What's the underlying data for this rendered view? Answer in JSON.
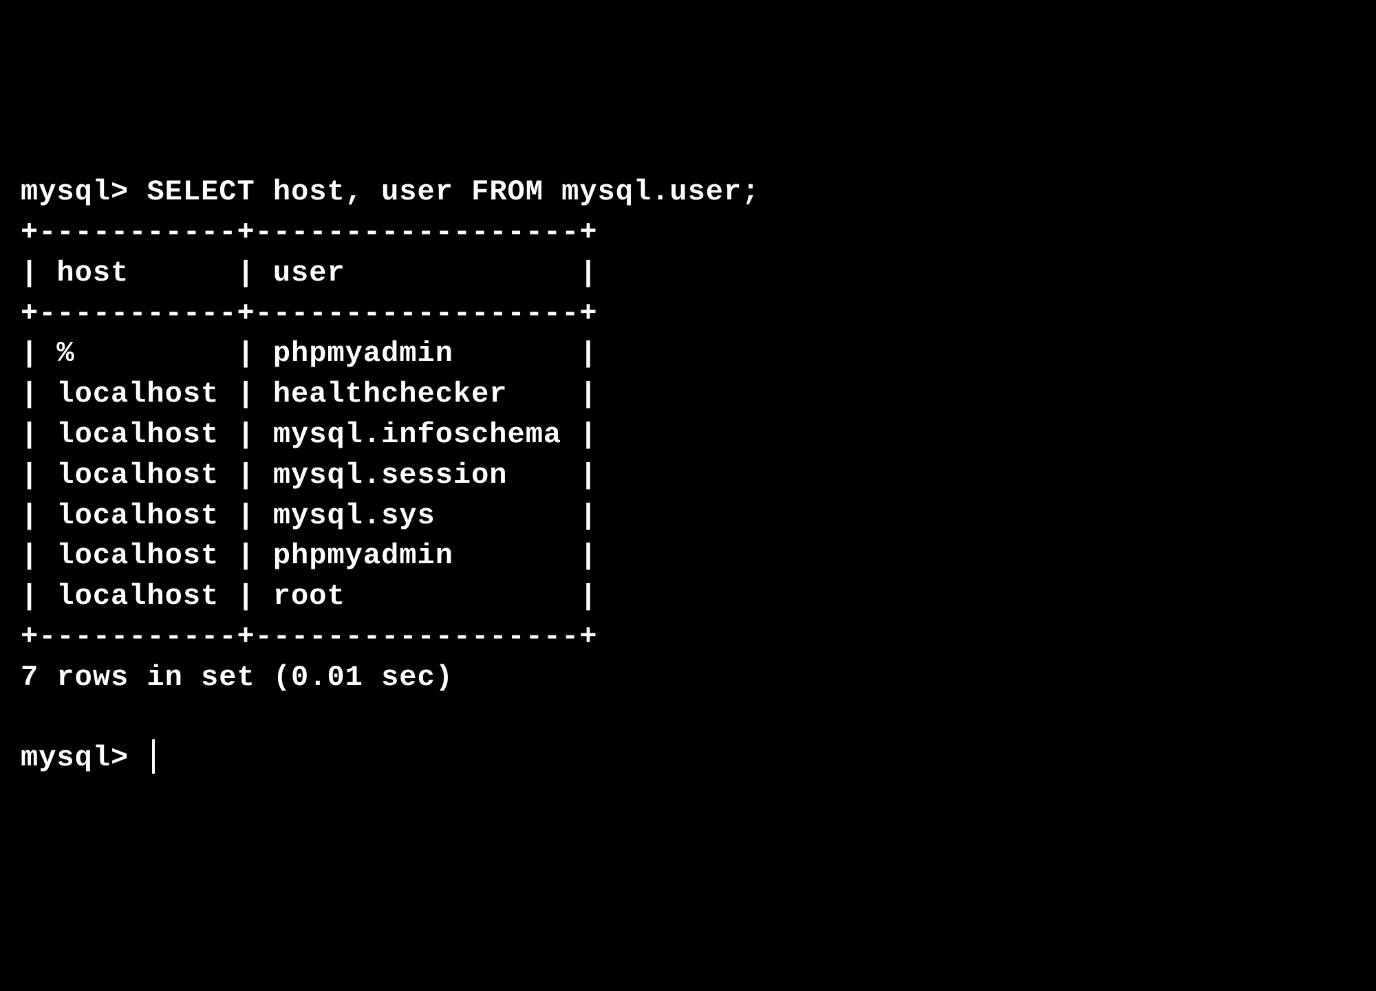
{
  "terminal": {
    "prompt": "mysql>",
    "command": "SELECT host, user FROM mysql.user;",
    "table": {
      "border_top": "+-----------+------------------+",
      "border_mid": "+-----------+------------------+",
      "border_bot": "+-----------+------------------+",
      "headers": [
        "host",
        "user"
      ],
      "header_line": "| host      | user             |",
      "rows": [
        {
          "host": "%",
          "user": "phpmyadmin",
          "line": "| %         | phpmyadmin       |"
        },
        {
          "host": "localhost",
          "user": "healthchecker",
          "line": "| localhost | healthchecker    |"
        },
        {
          "host": "localhost",
          "user": "mysql.infoschema",
          "line": "| localhost | mysql.infoschema |"
        },
        {
          "host": "localhost",
          "user": "mysql.session",
          "line": "| localhost | mysql.session    |"
        },
        {
          "host": "localhost",
          "user": "mysql.sys",
          "line": "| localhost | mysql.sys        |"
        },
        {
          "host": "localhost",
          "user": "phpmyadmin",
          "line": "| localhost | phpmyadmin       |"
        },
        {
          "host": "localhost",
          "user": "root",
          "line": "| localhost | root             |"
        }
      ]
    },
    "summary": "7 rows in set (0.01 sec)",
    "next_prompt": "mysql> "
  }
}
